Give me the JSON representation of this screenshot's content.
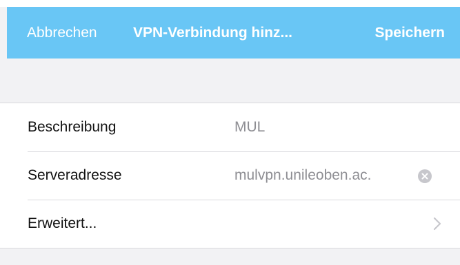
{
  "navbar": {
    "cancel_label": "Abbrechen",
    "title": "VPN-Verbindung hinz...",
    "save_label": "Speichern",
    "background_color": "#69c6f5"
  },
  "form": {
    "rows": [
      {
        "label": "Beschreibung",
        "value": "MUL"
      },
      {
        "label": "Serveradresse",
        "value": "mulvpn.unileoben.ac.",
        "clear_icon": "clear-circle-icon"
      },
      {
        "label": "Erweitert...",
        "accessory_icon": "chevron-right-icon"
      }
    ]
  }
}
